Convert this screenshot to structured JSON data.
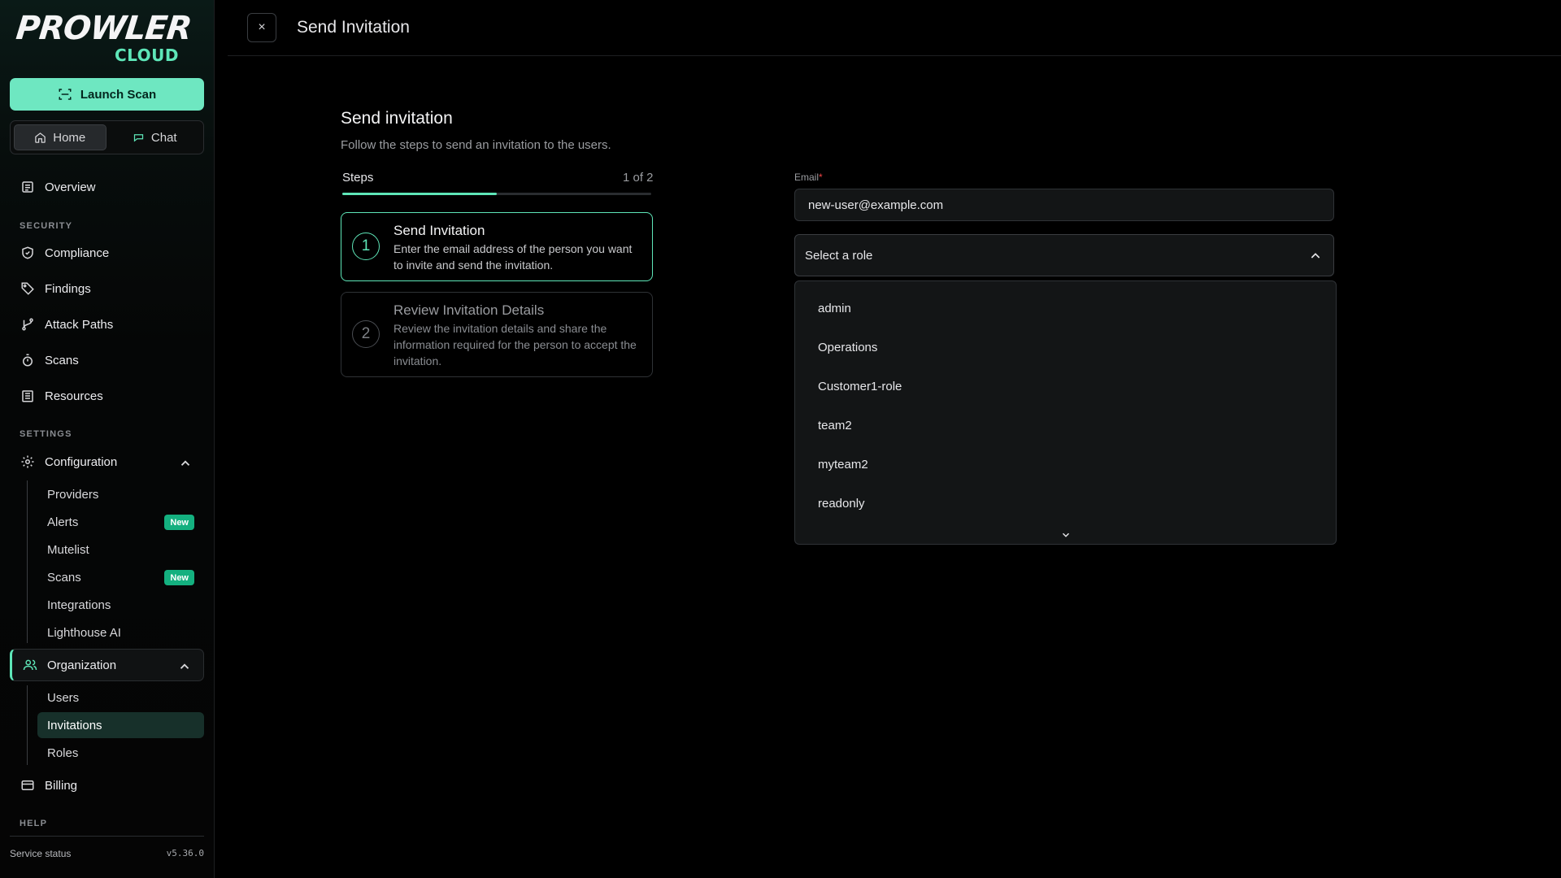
{
  "brand": {
    "name": "PROWLER",
    "tier": "CLOUD"
  },
  "sidebar": {
    "launch_label": "Launch Scan",
    "segments": [
      {
        "label": "Home"
      },
      {
        "label": "Chat"
      }
    ],
    "overview": "Overview",
    "security_heading": "SECURITY",
    "security_items": [
      {
        "label": "Compliance",
        "icon": "shield-icon"
      },
      {
        "label": "Findings",
        "icon": "tag-icon"
      },
      {
        "label": "Attack Paths",
        "icon": "git-branch-icon"
      },
      {
        "label": "Scans",
        "icon": "timer-icon"
      },
      {
        "label": "Resources",
        "icon": "building-icon"
      }
    ],
    "settings_heading": "SETTINGS",
    "configuration": {
      "label": "Configuration",
      "children": [
        {
          "label": "Providers"
        },
        {
          "label": "Alerts",
          "badge": "New"
        },
        {
          "label": "Mutelist"
        },
        {
          "label": "Scans",
          "badge": "New"
        },
        {
          "label": "Integrations"
        },
        {
          "label": "Lighthouse AI"
        }
      ]
    },
    "organization": {
      "label": "Organization",
      "children": [
        {
          "label": "Users"
        },
        {
          "label": "Invitations"
        },
        {
          "label": "Roles"
        }
      ]
    },
    "billing": "Billing",
    "help_heading": "HELP",
    "service_status": "Service status",
    "version": "v5.36.0"
  },
  "header": {
    "title": "Send Invitation",
    "close_symbol": "×"
  },
  "main": {
    "title": "Send invitation",
    "subtitle": "Follow the steps to send an invitation to the users.",
    "steps_label": "Steps",
    "steps_count": "1 of 2",
    "progress_fraction": 0.5,
    "steps": [
      {
        "number": "1",
        "title": "Send Invitation",
        "description": "Enter the email address of the person you want to invite and send the invitation."
      },
      {
        "number": "2",
        "title": "Review Invitation Details",
        "description": "Review the invitation details and share the information required for the person to accept the invitation."
      }
    ],
    "form": {
      "email_label": "Email",
      "required_mark": "*",
      "email_value": "new-user@example.com",
      "role_placeholder": "Select a role",
      "role_options": [
        "admin",
        "Operations",
        "Customer1-role",
        "team2",
        "myteam2",
        "readonly"
      ]
    }
  },
  "colors": {
    "accent": "#5ee6b8",
    "launch_button": "#6ee7c1",
    "badge": "#14b07f",
    "background": "#000000"
  }
}
